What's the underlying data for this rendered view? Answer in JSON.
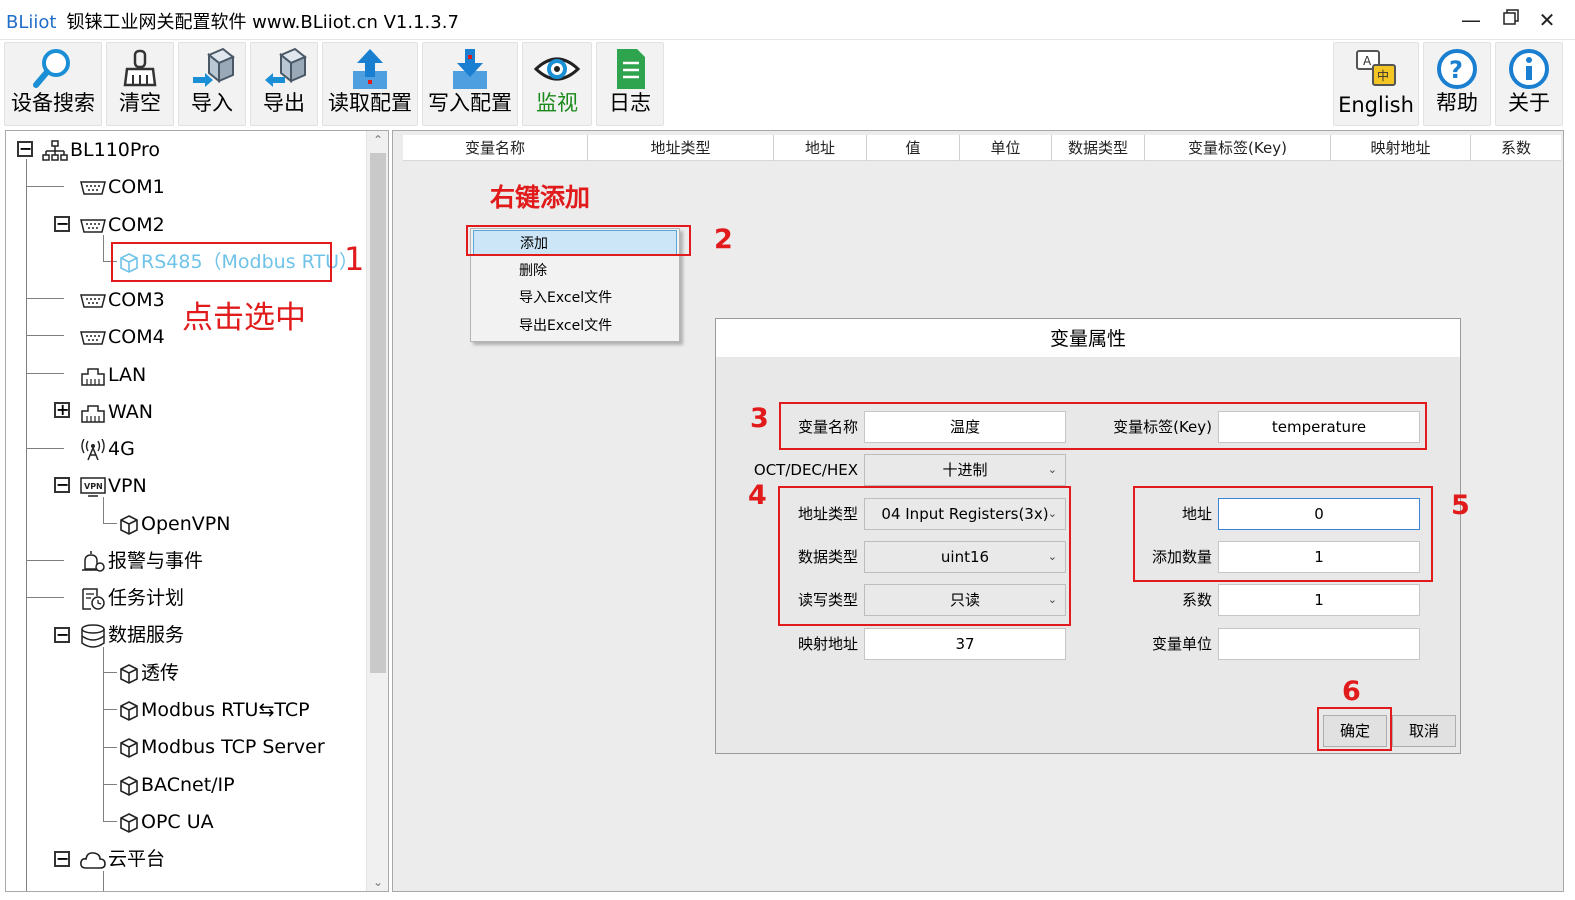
{
  "window": {
    "brand": "BLiiot",
    "title": "钡铼工业网关配置软件 www.BLiiot.cn V1.1.3.7",
    "controls": [
      "minimize-icon",
      "restore-icon",
      "close-icon"
    ]
  },
  "toolbar": {
    "left_buttons": [
      {
        "label": "设备搜索",
        "icon": "search-icon"
      },
      {
        "label": "清空",
        "icon": "broom-icon"
      },
      {
        "label": "导入",
        "icon": "import-box-icon"
      },
      {
        "label": "导出",
        "icon": "export-box-icon"
      },
      {
        "label": "读取配置",
        "icon": "upload-arrow-icon"
      },
      {
        "label": "写入配置",
        "icon": "download-arrow-icon"
      },
      {
        "label": "监视",
        "icon": "eye-icon"
      },
      {
        "label": "日志",
        "icon": "log-document-icon"
      }
    ],
    "right_buttons": [
      {
        "label": "English",
        "icon": "language-icon"
      },
      {
        "label": "帮助",
        "icon": "help-icon"
      },
      {
        "label": "关于",
        "icon": "info-icon"
      }
    ],
    "monitor_label_color": "#1a8a1a"
  },
  "tree": {
    "root": "BL110Pro",
    "items": [
      {
        "label": "COM1",
        "icon": "serial-port-icon"
      },
      {
        "label": "COM2",
        "icon": "serial-port-icon",
        "expanded": true
      },
      {
        "label": "RS485（Modbus RTU）",
        "icon": "cube-icon",
        "selected": true
      },
      {
        "label": "COM3",
        "icon": "serial-port-icon"
      },
      {
        "label": "COM4",
        "icon": "serial-port-icon"
      },
      {
        "label": "LAN",
        "icon": "network-port-icon"
      },
      {
        "label": "WAN",
        "icon": "network-port-icon",
        "expanded": false
      },
      {
        "label": "4G",
        "icon": "antenna-icon"
      },
      {
        "label": "VPN",
        "icon": "vpn-icon",
        "expanded": true
      },
      {
        "label": "OpenVPN",
        "icon": "cube-icon"
      },
      {
        "label": "报警与事件",
        "icon": "alarm-gear-icon"
      },
      {
        "label": "任务计划",
        "icon": "schedule-icon"
      },
      {
        "label": "数据服务",
        "icon": "database-icon",
        "expanded": true
      },
      {
        "label": "透传",
        "icon": "cube-icon"
      },
      {
        "label": "Modbus RTU⇆TCP",
        "icon": "cube-icon"
      },
      {
        "label": "Modbus TCP Server",
        "icon": "cube-icon"
      },
      {
        "label": "BACnet/IP",
        "icon": "cube-icon"
      },
      {
        "label": "OPC UA",
        "icon": "cube-icon"
      },
      {
        "label": "云平台",
        "icon": "cloud-icon",
        "expanded": true
      }
    ],
    "selected_color": "#6fc3e8"
  },
  "table": {
    "columns": [
      "变量名称",
      "地址类型",
      "地址",
      "值",
      "单位",
      "数据类型",
      "变量标签(Key)",
      "映射地址",
      "系数"
    ]
  },
  "annotations": {
    "step1": "1",
    "click_select": "点击选中",
    "right_click_add": "右键添加",
    "step2": "2",
    "step3": "3",
    "step4": "4",
    "step5": "5",
    "step6": "6",
    "color": "#e11b1b"
  },
  "context_menu": {
    "items": [
      "添加",
      "删除",
      "导入Excel文件",
      "导出Excel文件"
    ]
  },
  "dialog": {
    "title": "变量属性",
    "var_name_label": "变量名称",
    "var_name_value": "温度",
    "var_key_label": "变量标签(Key)",
    "var_key_value": "temperature",
    "radix_label": "OCT/DEC/HEX",
    "radix_value": "十进制",
    "addr_type_label": "地址类型",
    "addr_type_value": "04 Input Registers(3x)",
    "addr_label": "地址",
    "addr_value": "0",
    "data_type_label": "数据类型",
    "data_type_value": "uint16",
    "add_count_label": "添加数量",
    "add_count_value": "1",
    "rw_type_label": "读写类型",
    "rw_type_value": "只读",
    "coef_label": "系数",
    "coef_value": "1",
    "map_addr_label": "映射地址",
    "map_addr_value": "37",
    "unit_label": "变量单位",
    "unit_value": "",
    "ok_label": "确定",
    "cancel_label": "取消"
  }
}
